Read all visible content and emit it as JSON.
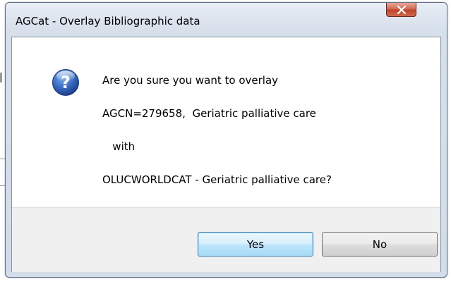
{
  "window": {
    "title": "AGCat - Overlay Bibliographic data"
  },
  "message": {
    "lines": [
      "Are you sure you want to overlay",
      "AGCN=279658,  Geriatric palliative care",
      "   with",
      "OLUCWORLDCAT - Geriatric palliative care?"
    ]
  },
  "buttons": {
    "yes_label": "Yes",
    "no_label": "No"
  },
  "icons": {
    "dialog_icon": "question-icon",
    "close_icon": "close-icon"
  },
  "colors": {
    "close_button": "#c7472e",
    "question_icon": "#2a5db0",
    "button_face": "#e5e5e5",
    "footer": "#f0f0f0"
  }
}
